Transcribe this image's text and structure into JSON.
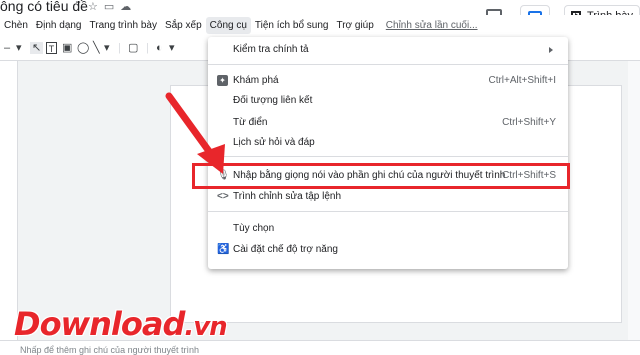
{
  "document": {
    "title": "ông có tiêu đề"
  },
  "header": {
    "present_label": "Trình bày"
  },
  "menubar": {
    "items": [
      "Chèn",
      "Định dạng",
      "Trang trình bày",
      "Sắp xếp",
      "Công cụ",
      "Tiện ích bổ sung",
      "Trợ giúp"
    ],
    "last_edit": "Chỉnh sửa lần cuối..."
  },
  "tools_menu": {
    "items": [
      {
        "label": "Kiểm tra chính tả",
        "shortcut": ""
      },
      {
        "label": "Khám phá",
        "shortcut": "Ctrl+Alt+Shift+I"
      },
      {
        "label": "Đối tượng liên kết",
        "shortcut": ""
      },
      {
        "label": "Từ điển",
        "shortcut": "Ctrl+Shift+Y"
      },
      {
        "label": "Lịch sử hỏi và đáp",
        "shortcut": ""
      },
      {
        "label": "Nhập bằng giọng nói vào phần ghi chú của người thuyết trình",
        "shortcut": "Ctrl+Shift+S"
      },
      {
        "label": "Trình chỉnh sửa tập lệnh",
        "shortcut": ""
      },
      {
        "label": "Tùy chọn",
        "shortcut": ""
      },
      {
        "label": "Cài đặt chế độ trợ năng",
        "shortcut": ""
      }
    ]
  },
  "notes": {
    "text": "Nhấp để thêm ghi chú của người thuyết trình"
  },
  "watermark": {
    "main": "Download",
    "suffix": ".vn"
  },
  "colors": {
    "highlight": "#e8262b",
    "accent": "#1a73e8"
  }
}
